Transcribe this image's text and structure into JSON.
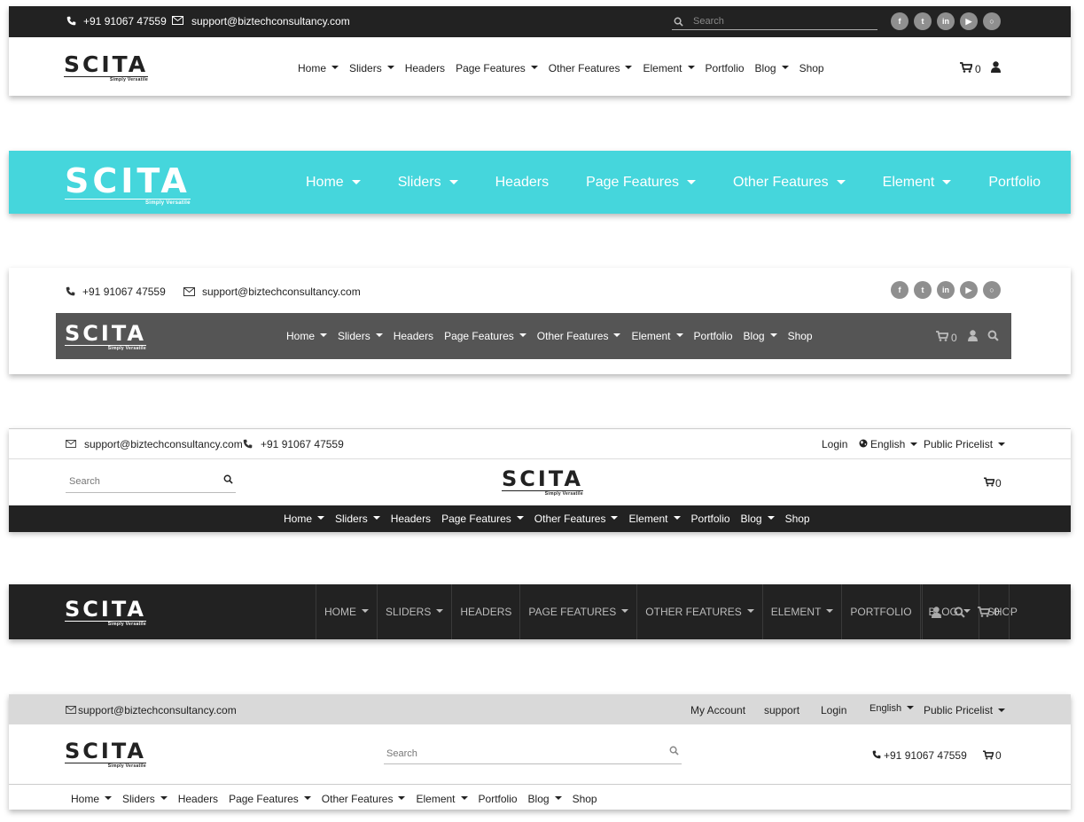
{
  "contact": {
    "phone": "+91 91067 47559",
    "email": "support@biztechconsultancy.com"
  },
  "logo": {
    "word": "SCITA",
    "tagline": "Simply Versatile"
  },
  "search_placeholder": "Search",
  "cart_count": "0",
  "social_icons": [
    "facebook-icon",
    "twitter-icon",
    "linkedin-icon",
    "youtube-icon",
    "instagram-icon"
  ],
  "menu": [
    {
      "label": "Home",
      "dropdown": true
    },
    {
      "label": "Sliders",
      "dropdown": true
    },
    {
      "label": "Headers",
      "dropdown": false
    },
    {
      "label": "Page Features",
      "dropdown": true
    },
    {
      "label": "Other Features",
      "dropdown": true
    },
    {
      "label": "Element",
      "dropdown": true
    },
    {
      "label": "Portfolio",
      "dropdown": false
    },
    {
      "label": "Blog",
      "dropdown": true
    },
    {
      "label": "Shop",
      "dropdown": false
    }
  ],
  "menu_upper": [
    "HOME",
    "SLIDERS",
    "HEADERS",
    "PAGE FEATURES",
    "OTHER FEATURES",
    "ELEMENT",
    "PORTFOLIO",
    "BLOG",
    "SHOP"
  ],
  "header4": {
    "login": "Login",
    "language": "English",
    "pricelist": "Public Pricelist"
  },
  "header6": {
    "my_account": "My Account",
    "support": "support",
    "login": "Login",
    "language": "English",
    "pricelist": "Public Pricelist"
  },
  "colors": {
    "dark": "#222222",
    "teal": "#45d6dc",
    "gray_bar": "#555555",
    "light_bar": "#d9d9d9",
    "social": "#8f8f8f"
  }
}
